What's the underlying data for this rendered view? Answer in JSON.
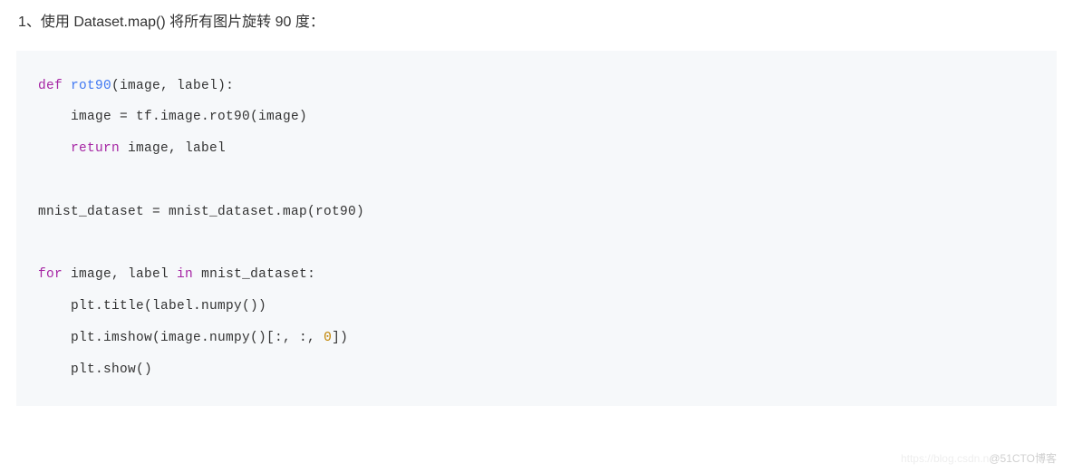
{
  "heading": "1、使用 Dataset.map() 将所有图片旋转 90 度：",
  "code": {
    "l1_kw1": "def",
    "l1_fn": "rot90",
    "l1_args": "(image, label)",
    "l1_colon": ":",
    "l2": "    image = tf.image.rot90(image)",
    "l3_kw": "return",
    "l3_rest": " image, label",
    "l4": "mnist_dataset = mnist_dataset.map(rot90)",
    "l5_kw": "for",
    "l5_mid": " image, label ",
    "l5_kw2": "in",
    "l5_rest": " mnist_dataset:",
    "l6": "    plt.title(label.numpy())",
    "l7_pre": "    plt.imshow(image.numpy()[:, :, ",
    "l7_num": "0",
    "l7_post": "])",
    "l8": "    plt.show()"
  },
  "watermark_faded": "https://blog.csdn.n",
  "watermark": "@51CTO博客"
}
